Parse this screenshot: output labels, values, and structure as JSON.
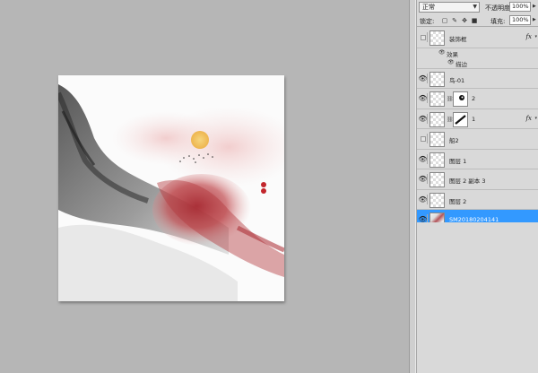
{
  "panel": {
    "blend_mode": "正常",
    "opacity_label": "不透明度:",
    "opacity_value": "100%",
    "lock_label": "锁定:",
    "fill_label": "填充:",
    "fill_value": "100%"
  },
  "layers": [
    {
      "name": "装饰框",
      "visible": false,
      "fx": "fx"
    },
    {
      "effects_label": "效果"
    },
    {
      "effect_name": "描边"
    },
    {
      "name": "鸟-01",
      "visible": true
    },
    {
      "name": "2",
      "visible": true
    },
    {
      "name": "1",
      "visible": true,
      "fx": "fx"
    },
    {
      "name": "船2",
      "visible": false
    },
    {
      "name": "图层 1",
      "visible": true
    },
    {
      "name": "图层 2 副本 3",
      "visible": true
    },
    {
      "name": "图层 2",
      "visible": true
    },
    {
      "name": "SM20180204141",
      "visible": true,
      "selected": true
    }
  ],
  "colors": {
    "selected": "#3399ff",
    "panel_bg": "#d9d9d9",
    "workspace_bg": "#b6b6b6",
    "ink_red": "#b4393e",
    "sun": "#f0c25a"
  }
}
